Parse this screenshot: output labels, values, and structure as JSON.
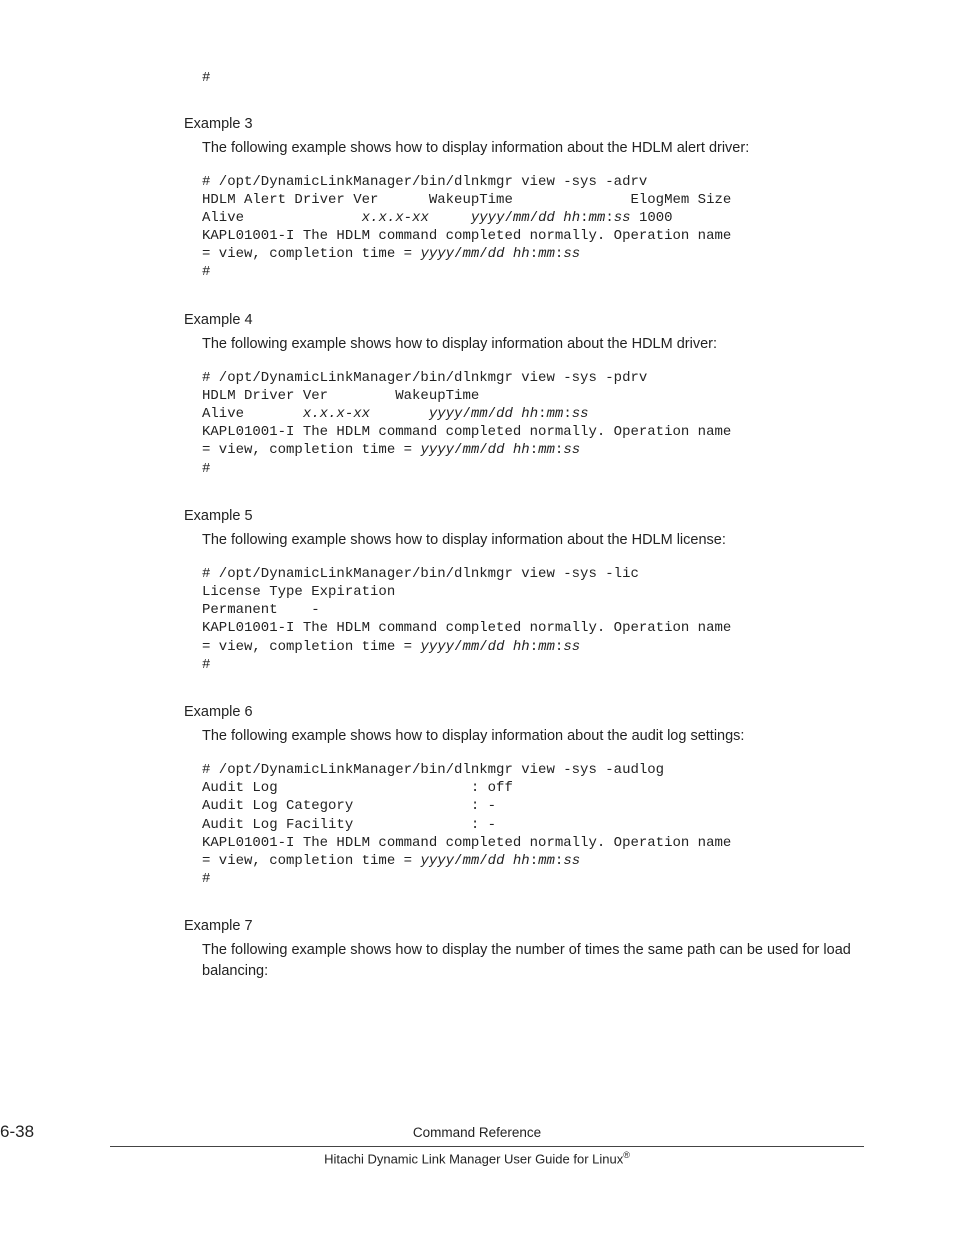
{
  "code0": {
    "hash": "#"
  },
  "ex3": {
    "heading": "Example 3",
    "intro": "The following example shows how to display information about the HDLM alert driver:",
    "l1": "# /opt/DynamicLinkManager/bin/dlnkmgr view -sys -adrv",
    "l2": "HDLM Alert Driver Ver      WakeupTime              ElogMem Size",
    "l3a": "Alive              ",
    "l3b": "x.x.x-xx     yyyy",
    "l3c": "/",
    "l3d": "mm",
    "l3e": "/",
    "l3f": "dd hh",
    "l3g": ":",
    "l3h": "mm",
    "l3i": ":",
    "l3j": "ss",
    "l3k": " 1000",
    "l4": "KAPL01001-I The HDLM command completed normally. Operation name",
    "l5a": "= view, completion time = ",
    "l5b": "yyyy",
    "l5c": "/",
    "l5d": "mm",
    "l5e": "/",
    "l5f": "dd hh",
    "l5g": ":",
    "l5h": "mm",
    "l5i": ":",
    "l5j": "ss",
    "l6": "#"
  },
  "ex4": {
    "heading": "Example 4",
    "intro": "The following example shows how to display information about the HDLM driver:",
    "l1": "# /opt/DynamicLinkManager/bin/dlnkmgr view -sys -pdrv",
    "l2": "HDLM Driver Ver        WakeupTime",
    "l3a": "Alive       ",
    "l3b": "x.x.x-xx       yyyy",
    "l3c": "/",
    "l3d": "mm",
    "l3e": "/",
    "l3f": "dd hh",
    "l3g": ":",
    "l3h": "mm",
    "l3i": ":",
    "l3j": "ss",
    "l4": "KAPL01001-I The HDLM command completed normally. Operation name",
    "l5a": "= view, completion time = ",
    "l5b": "yyyy",
    "l5c": "/",
    "l5d": "mm",
    "l5e": "/",
    "l5f": "dd hh",
    "l5g": ":",
    "l5h": "mm",
    "l5i": ":",
    "l5j": "ss",
    "l6": "#"
  },
  "ex5": {
    "heading": "Example 5",
    "intro": "The following example shows how to display information about the HDLM license:",
    "l1": "# /opt/DynamicLinkManager/bin/dlnkmgr view -sys -lic",
    "l2": "License Type Expiration",
    "l3": "Permanent    -",
    "l4": "KAPL01001-I The HDLM command completed normally. Operation name",
    "l5a": "= view, completion time = ",
    "l5b": "yyyy",
    "l5c": "/",
    "l5d": "mm",
    "l5e": "/",
    "l5f": "dd hh",
    "l5g": ":",
    "l5h": "mm",
    "l5i": ":",
    "l5j": "ss",
    "l6": "#"
  },
  "ex6": {
    "heading": "Example 6",
    "intro": "The following example shows how to display information about the audit log settings:",
    "l1": "# /opt/DynamicLinkManager/bin/dlnkmgr view -sys -audlog",
    "l2": "Audit Log                       : off",
    "l3": "Audit Log Category              : -",
    "l4": "Audit Log Facility              : -",
    "l5": "KAPL01001-I The HDLM command completed normally. Operation name",
    "l6a": "= view, completion time = ",
    "l6b": "yyyy",
    "l6c": "/",
    "l6d": "mm",
    "l6e": "/",
    "l6f": "dd hh",
    "l6g": ":",
    "l6h": "mm",
    "l6i": ":",
    "l6j": "ss",
    "l7": "#"
  },
  "ex7": {
    "heading": "Example 7",
    "intro": "The following example shows how to display the number of times the same path can be used for load balancing:"
  },
  "footer": {
    "pagenum": "6-38",
    "title": "Command Reference",
    "sub_pre": "Hitachi Dynamic Link Manager User Guide for Linux",
    "sub_sup": "®"
  }
}
